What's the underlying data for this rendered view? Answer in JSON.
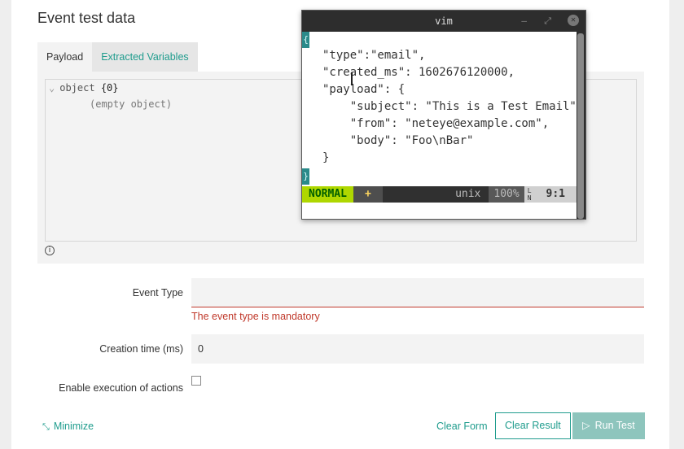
{
  "page": {
    "title": "Event test data"
  },
  "tabs": [
    {
      "label": "Payload",
      "active": true
    },
    {
      "label": "Extracted Variables",
      "active": false
    }
  ],
  "json_view": {
    "root_kind": "object",
    "root_count": "{0}",
    "empty_text": "(empty object)"
  },
  "form": {
    "event_type_label": "Event Type",
    "event_type_value": "",
    "event_type_error": "The event type is mandatory",
    "creation_time_label": "Creation time (ms)",
    "creation_time_value": "0",
    "enable_actions_label": "Enable execution of actions",
    "enable_actions_checked": false
  },
  "footer": {
    "minimize_label": "Minimize",
    "clear_form_label": "Clear Form",
    "clear_result_label": "Clear Result",
    "run_test_label": "Run Test"
  },
  "vim": {
    "title": "vim",
    "lines": [
      "\"type\":\"email\",",
      "\"created_ms\": 1602676120000,",
      "\"payload\": {",
      "    \"subject\": \"This is a Test Email\",",
      "    \"from\": \"neteye@example.com\",",
      "    \"body\": \"Foo\\nBar\"",
      "}"
    ],
    "open_brace": "{",
    "close_brace": "}",
    "status": {
      "mode": "NORMAL",
      "modified": "+",
      "fileformat": "unix",
      "percent": "100%",
      "ln_icon_top": "L",
      "ln_icon_bottom": "N",
      "position": "9:1"
    }
  },
  "colors": {
    "accent": "#1f9c8d",
    "error": "#c0392b",
    "vim_mode_bg": "#afd700"
  }
}
